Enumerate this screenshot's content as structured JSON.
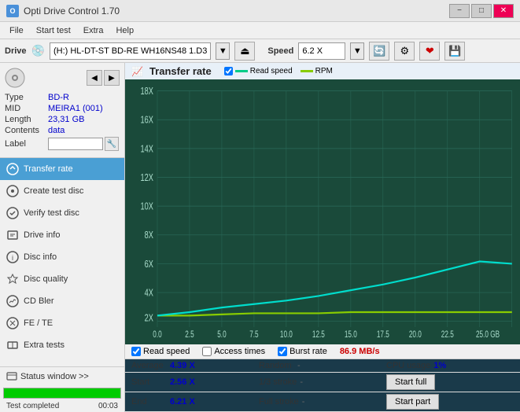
{
  "titlebar": {
    "title": "Opti Drive Control 1.70",
    "minimize": "−",
    "maximize": "□",
    "close": "✕"
  },
  "menu": {
    "items": [
      "File",
      "Start test",
      "Extra",
      "Help"
    ]
  },
  "drive_bar": {
    "drive_label": "Drive",
    "drive_icon": "💿",
    "drive_value": "(H:)  HL-DT-ST BD-RE  WH16NS48 1.D3",
    "speed_label": "Speed",
    "speed_value": "6.2 X"
  },
  "disc": {
    "type_label": "Type",
    "type_value": "BD-R",
    "mid_label": "MID",
    "mid_value": "MEIRA1 (001)",
    "length_label": "Length",
    "length_value": "23,31 GB",
    "contents_label": "Contents",
    "contents_value": "data",
    "label_label": "Label",
    "label_value": ""
  },
  "nav_items": [
    {
      "id": "transfer-rate",
      "label": "Transfer rate",
      "active": true
    },
    {
      "id": "create-test-disc",
      "label": "Create test disc",
      "active": false
    },
    {
      "id": "verify-test-disc",
      "label": "Verify test disc",
      "active": false
    },
    {
      "id": "drive-info",
      "label": "Drive info",
      "active": false
    },
    {
      "id": "disc-info",
      "label": "Disc info",
      "active": false
    },
    {
      "id": "disc-quality",
      "label": "Disc quality",
      "active": false
    },
    {
      "id": "cd-bler",
      "label": "CD Bler",
      "active": false
    },
    {
      "id": "fe-te",
      "label": "FE / TE",
      "active": false
    },
    {
      "id": "extra-tests",
      "label": "Extra tests",
      "active": false
    }
  ],
  "status": {
    "window_label": "Status window >>",
    "test_completed": "Test completed",
    "progress": 100,
    "time": "00:03"
  },
  "chart": {
    "title": "Transfer rate",
    "legend_read": "Read speed",
    "legend_rpm": "RPM",
    "y_axis": [
      "18X",
      "16X",
      "14X",
      "12X",
      "10X",
      "8X",
      "6X",
      "4X",
      "2X"
    ],
    "x_axis": [
      "0.0",
      "2.5",
      "5.0",
      "7.5",
      "10.0",
      "12.5",
      "15.0",
      "17.5",
      "20.0",
      "22.5",
      "25.0 GB"
    ]
  },
  "checkboxes": {
    "read_speed": {
      "label": "Read speed",
      "checked": true
    },
    "access_times": {
      "label": "Access times",
      "checked": false
    },
    "burst_rate": {
      "label": "Burst rate",
      "checked": true
    },
    "burst_value": "86.9 MB/s"
  },
  "stats": {
    "average_label": "Average",
    "average_value": "4.39 X",
    "random_label": "Random",
    "random_value": "-",
    "cpu_label": "CPU usage",
    "cpu_value": "1%",
    "start_label": "Start",
    "start_value": "2.56 X",
    "stroke_1_3_label": "1/3 stroke",
    "stroke_1_3_value": "-",
    "start_full_label": "Start full",
    "end_label": "End",
    "end_value": "6.21 X",
    "full_stroke_label": "Full stroke",
    "full_stroke_value": "-",
    "start_part_label": "Start part"
  }
}
